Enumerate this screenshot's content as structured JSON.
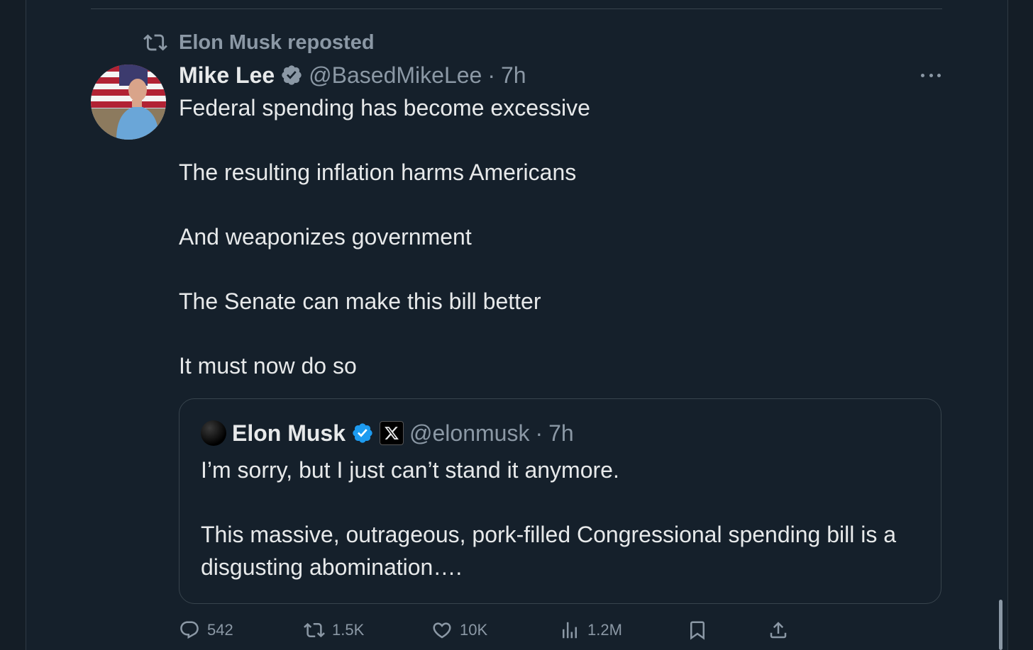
{
  "repost": {
    "label": "Elon Musk reposted"
  },
  "tweet": {
    "author_name": "Mike Lee",
    "handle": "@BasedMikeLee",
    "dot": "·",
    "time": "7h",
    "lines": [
      "Federal spending has become excessive",
      "The resulting inflation harms Americans",
      "And weaponizes government",
      "The Senate can make this bill better",
      "It must now do so"
    ]
  },
  "quote": {
    "author_name": "Elon Musk",
    "handle": "@elonmusk",
    "dot": "·",
    "time": "7h",
    "line1": "I’m sorry, but I just can’t stand it anymore.",
    "line2": "This massive, outrageous, pork-filled Congressional spending bill is a disgusting abomination…."
  },
  "actions": {
    "replies": "542",
    "reposts": "1.5K",
    "likes": "10K",
    "views": "1.2M"
  },
  "colors": {
    "background": "#15202b",
    "text": "#e7e9ea",
    "muted": "#8b98a5",
    "verified": "#1d9bf0",
    "border": "#38444d"
  },
  "icons": [
    "repost-icon",
    "verified-icon",
    "more-icon",
    "x-logo-icon",
    "reply-icon",
    "repost-icon",
    "like-icon",
    "views-icon",
    "bookmark-icon",
    "share-icon"
  ]
}
